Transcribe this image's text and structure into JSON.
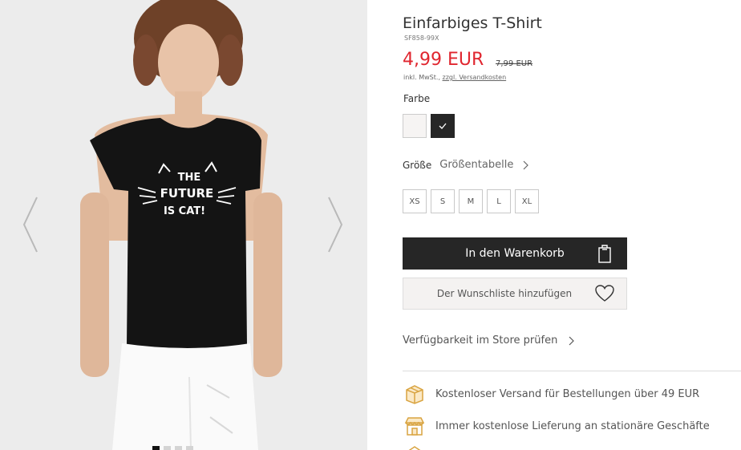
{
  "gallery": {
    "print_line1": "THE",
    "print_line2": "FUTURE",
    "print_line3": "IS CAT!",
    "slide_count": 4,
    "active_slide": 1
  },
  "product": {
    "title": "Einfarbiges T-Shirt",
    "sku": "SF858-99X",
    "price": "4,99 EUR",
    "old_price": "7,99 EUR",
    "vat_text": "inkl. MwSt., ",
    "shipping_link": "zzgl. Versandkosten"
  },
  "color": {
    "label": "Farbe",
    "options": [
      "white",
      "black"
    ],
    "selected": "black"
  },
  "size": {
    "label": "Größe",
    "table_link": "Größentabelle",
    "options": [
      "XS",
      "S",
      "M",
      "L",
      "XL"
    ]
  },
  "actions": {
    "cart_label": "In den Warenkorb",
    "wishlist_label": "Der Wunschliste hinzufügen",
    "store_check_label": "Verfügbarkeit im Store prüfen"
  },
  "benefits": [
    "Kostenloser Versand für Bestellungen über 49 EUR",
    "Immer kostenlose Lieferung an stationäre Geschäfte"
  ],
  "colors": {
    "price_red": "#e0262f",
    "benefit_icon_gold": "#d9a441",
    "button_dark": "#262626"
  }
}
